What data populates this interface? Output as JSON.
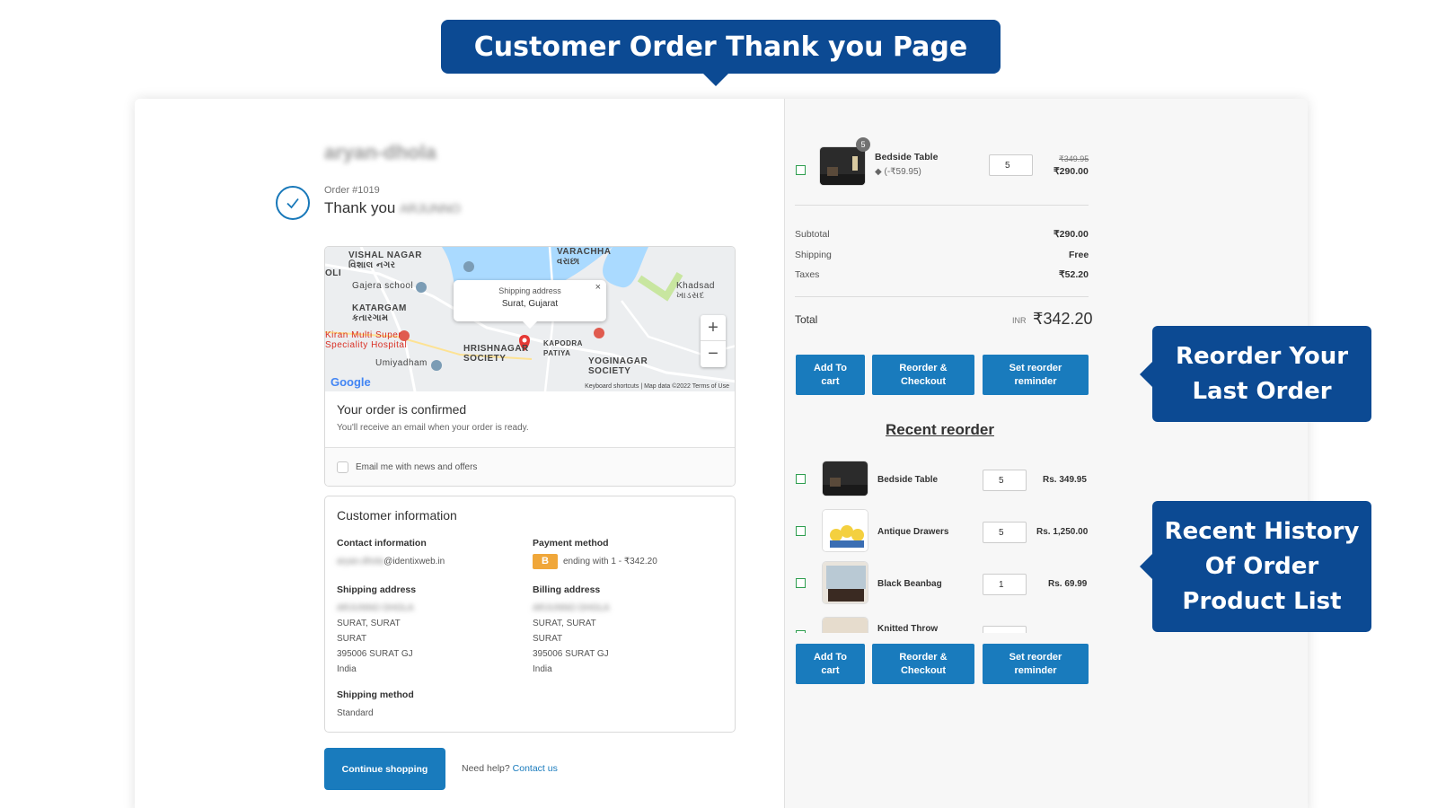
{
  "banner": {
    "title": "Customer Order Thank you Page"
  },
  "order": {
    "shop_name": "aryan-dhola",
    "order_number": "Order #1019",
    "thank_you": "Thank you",
    "customer_name": "ARJUNNO"
  },
  "map": {
    "popup_title": "Shipping address",
    "popup_location": "Surat, Gujarat",
    "popup_close": "×",
    "zoom_in": "+",
    "zoom_out": "−",
    "google": "Google",
    "footer": "Keyboard shortcuts | Map data ©2022   Terms of Use",
    "labels": {
      "vishal": "VISHAL NAGAR",
      "vishal_gu": "વિશાલ નગર",
      "katargam": "KATARGAM",
      "katargam_gu": "કતારગામ",
      "gajera": "Gajera school",
      "kiran": "Kiran Multi Super",
      "speciality": "Speciality Hospital",
      "umiyadham": "Umiyadham",
      "hrishnagar": "HRISHNAGAR",
      "society": "SOCIETY",
      "kapodra": "KAPODRA",
      "patiya": "PATIYA",
      "yoginagar": "YOGINAGAR",
      "yoginagar_society": "SOCIETY",
      "khadsad": "Khadsad",
      "khadsad_gu": "ખાડસદ",
      "varachha": "VARACHHA",
      "varachha_gu": "વરાછા",
      "oli": "OLI"
    }
  },
  "confirmation": {
    "title": "Your order is confirmed",
    "subtitle": "You'll receive an email when your order is ready.",
    "email_opt": "Email me with news and offers"
  },
  "customer": {
    "title": "Customer information",
    "contact_heading": "Contact information",
    "contact_email_hidden": "aryan.dhola",
    "contact_email_domain": "@identixweb.in",
    "payment_heading": "Payment method",
    "payment_badge": "B",
    "payment_text": "ending with 1 - ₹342.20",
    "shipping_heading": "Shipping address",
    "shipping_name": "ARJUNNO DHOLA",
    "shipping_line1": "SURAT, SURAT",
    "shipping_line2": "SURAT",
    "shipping_line3": "395006 SURAT GJ",
    "shipping_line4": "India",
    "billing_heading": "Billing address",
    "billing_name": "ARJUNNO DHOLA",
    "billing_line1": "SURAT, SURAT",
    "billing_line2": "SURAT",
    "billing_line3": "395006 SURAT GJ",
    "billing_line4": "India",
    "shipping_method_heading": "Shipping method",
    "shipping_method": "Standard"
  },
  "footer": {
    "continue": "Continue shopping",
    "help": "Need help?",
    "contact": "Contact us"
  },
  "cart_item": {
    "name": "Bedside Table",
    "discount": "(-₹59.95)",
    "qty_badge": "5",
    "qty": "5",
    "original_price": "₹349.95",
    "price": "₹290.00"
  },
  "summary": {
    "subtotal_label": "Subtotal",
    "subtotal": "₹290.00",
    "shipping_label": "Shipping",
    "shipping": "Free",
    "taxes_label": "Taxes",
    "taxes": "₹52.20",
    "total_label": "Total",
    "currency": "INR",
    "total": "₹342.20"
  },
  "actions": {
    "add_to_cart_1": "Add To",
    "add_to_cart_2": "cart",
    "reorder_1": "Reorder &",
    "reorder_2": "Checkout",
    "reminder_1": "Set reorder",
    "reminder_2": "reminder"
  },
  "recent": {
    "title": "Recent reorder",
    "items": [
      {
        "name": "Bedside Table",
        "qty": "5",
        "price": "Rs. 349.95"
      },
      {
        "name": "Antique Drawers",
        "qty": "5",
        "price": "Rs. 1,250.00"
      },
      {
        "name": "Black Beanbag",
        "qty": "1",
        "price": "Rs. 69.99"
      },
      {
        "name": "Knitted Throw",
        "qty": "",
        "price": ""
      }
    ]
  },
  "callouts": {
    "reorder_1": "Reorder Your",
    "reorder_2": "Last Order",
    "history_1": "Recent History",
    "history_2": "Of Order",
    "history_3": "Product List"
  },
  "colors": {
    "brand_navy": "#0c4a93",
    "button_blue": "#197bbd",
    "check_green": "#2e9e4f",
    "payment_orange": "#f0a73a"
  }
}
